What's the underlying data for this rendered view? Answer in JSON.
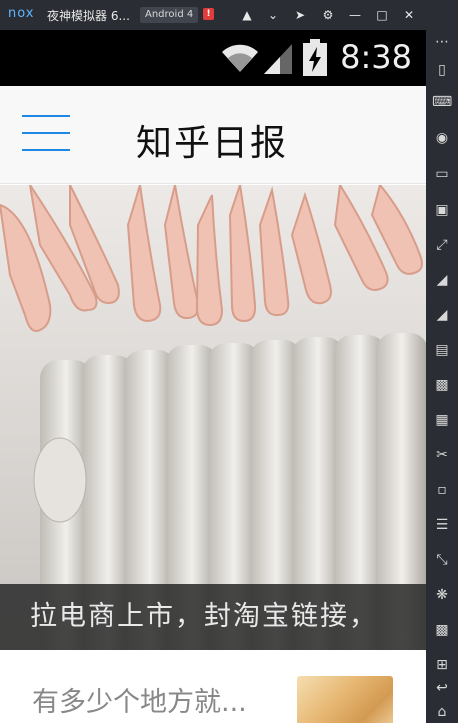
{
  "emulator": {
    "logo": "nox",
    "title": "夜神模拟器 6...",
    "android_badge": "Android 4",
    "alert": "!",
    "title_icons": [
      "home-icon",
      "chevron-down-icon",
      "pin-icon",
      "settings-icon",
      "minimize-icon",
      "maximize-icon",
      "close-icon"
    ],
    "sidebar_icons": [
      "more-icon",
      "shake-icon",
      "keyboard-icon",
      "location-icon",
      "screen-icon",
      "camera-icon",
      "fullscreen-icon",
      "volume-up-icon",
      "volume-down-icon",
      "toolbox-icon",
      "add-apk-icon",
      "apk-icon",
      "scissors-icon",
      "multi-instance-icon",
      "menu-icon",
      "resize-icon",
      "loading-icon",
      "video-icon",
      "macro-icon",
      "back-icon",
      "home-icon"
    ]
  },
  "status": {
    "time": "8:38"
  },
  "app": {
    "title": "知乎日报"
  },
  "hero": {
    "caption": "拉电商上市，封淘宝链接，"
  },
  "list": {
    "items": [
      {
        "title": "有多少个地方就..."
      }
    ]
  },
  "colors": {
    "accent": "#1e88e5",
    "statusbar": "#000000",
    "emulator_chrome": "#2a2d33"
  }
}
